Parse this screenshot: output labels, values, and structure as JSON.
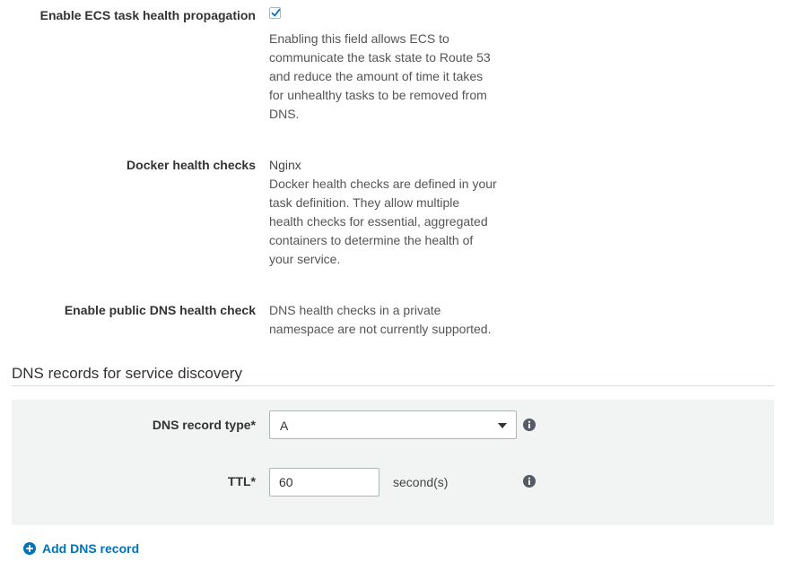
{
  "health": {
    "propagation": {
      "label": "Enable ECS task health propagation",
      "checked": true,
      "lines": [
        "Enabling this field allows ECS to",
        "communicate the task state to Route 53",
        "and reduce the amount of time it takes",
        "for unhealthy tasks to be removed from",
        "DNS."
      ]
    },
    "docker": {
      "label": "Docker health checks",
      "value": "Nginx",
      "lines": [
        "Docker health checks are defined in your",
        "task definition. They allow multiple",
        "health checks for essential, aggregated",
        "containers to determine the health of",
        "your service."
      ]
    },
    "public_dns": {
      "label": "Enable public DNS health check",
      "lines": [
        "DNS health checks in a private",
        "namespace are not currently supported."
      ]
    }
  },
  "dns_section": {
    "title": "DNS records for service discovery",
    "record_type": {
      "label": "DNS record type*",
      "selected": "A"
    },
    "ttl": {
      "label": "TTL*",
      "value": "60",
      "unit": "second(s)"
    },
    "add_record_label": "Add DNS record"
  },
  "colors": {
    "link": "#0073bb",
    "panel_bg": "#f2f3f3",
    "border": "#aab7b8",
    "info_icon": "#545b64"
  },
  "icons": {
    "checkbox_mark": "check-icon",
    "info": "info-icon",
    "dropdown": "caret-down-icon",
    "add": "plus-circle-icon"
  }
}
